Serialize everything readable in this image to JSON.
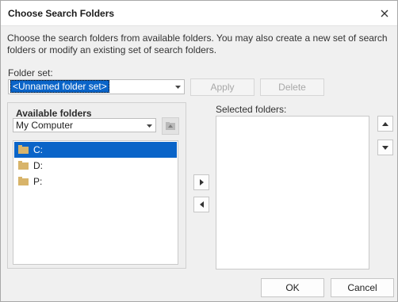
{
  "dialog": {
    "title": "Choose Search Folders",
    "description": "Choose the search folders from available folders. You may also create a new set of search folders or modify an existing set of search folders."
  },
  "folder_set": {
    "label": "Folder set:",
    "value": "<Unnamed folder set>",
    "apply_label": "Apply",
    "delete_label": "Delete"
  },
  "available": {
    "title": "Available folders",
    "location": "My Computer",
    "folders": [
      "C:",
      "D:",
      "P:"
    ],
    "selected_index": 0
  },
  "selected": {
    "label": "Selected folders:",
    "items": []
  },
  "footer": {
    "ok_label": "OK",
    "cancel_label": "Cancel"
  },
  "colors": {
    "accent": "#0a64c8",
    "folder_icon": "#d8b46a"
  }
}
